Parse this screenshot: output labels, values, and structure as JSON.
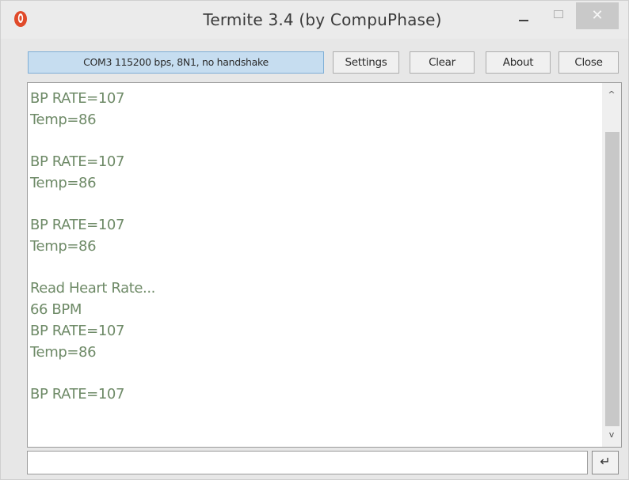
{
  "window": {
    "title": "Termite 3.4 (by CompuPhase)",
    "app_icon": "termite-app-icon",
    "controls": {
      "minimize_icon": "minimize-icon",
      "maximize_icon": "maximize-icon",
      "close_glyph": "✕"
    }
  },
  "toolbar": {
    "port_status": "COM3 115200 bps, 8N1, no handshake",
    "settings_label": "Settings",
    "clear_label": "Clear",
    "about_label": "About",
    "close_label": "Close"
  },
  "output": {
    "lines": [
      "BP RATE=107",
      "Temp=86",
      "",
      "BP RATE=107",
      "Temp=86",
      "",
      "BP RATE=107",
      "Temp=86",
      "",
      "Read Heart Rate...",
      "66 BPM",
      "BP RATE=107",
      "Temp=86",
      "",
      "BP RATE=107"
    ],
    "text_color": "#6e8a67",
    "scroll_up_glyph": "^",
    "scroll_down_glyph": "v"
  },
  "input": {
    "value": "",
    "send_glyph": "↵"
  },
  "colors": {
    "port_status_bg": "#c6ddf0",
    "close_button_bg": "#c9c9c9",
    "termite_icon": "#e04a2a"
  }
}
